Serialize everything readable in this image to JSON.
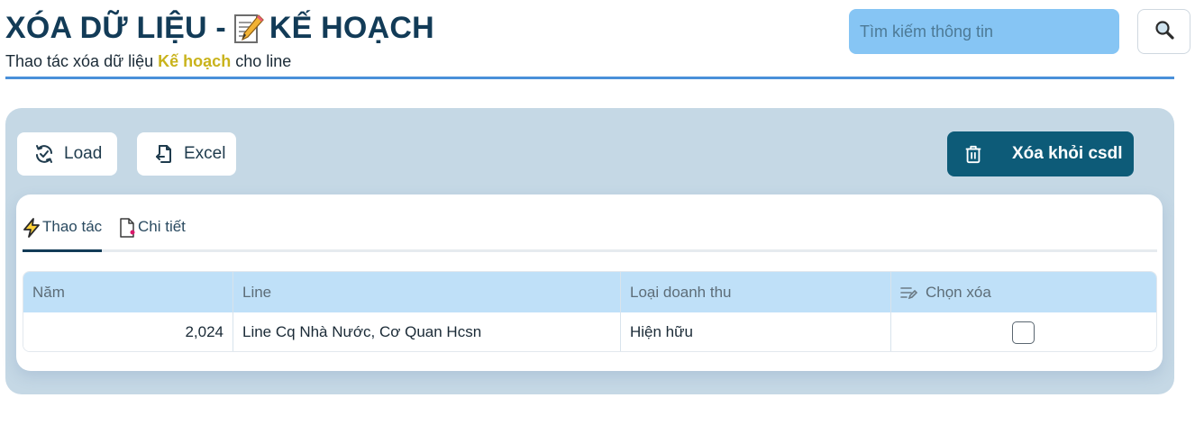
{
  "header": {
    "title_part1": "XÓA DỮ LIỆU -",
    "title_icon": "memo-icon",
    "title_part2": "KẾ HOẠCH",
    "subtitle_pre": "Thao tác xóa dữ liệu",
    "subtitle_highlight": "Kế hoạch",
    "subtitle_post": "cho line"
  },
  "search": {
    "placeholder": "Tìm kiếm thông tin",
    "value": "",
    "button_icon": "search-icon"
  },
  "toolbar": {
    "load_label": "Load",
    "load_icon": "refresh-icon",
    "excel_label": "Excel",
    "excel_icon": "file-export-icon",
    "delete_label": "Xóa khỏi csdl",
    "delete_icon": "trash-icon"
  },
  "tabs": [
    {
      "label": "Thao tác",
      "icon": "lightning-icon",
      "active": true
    },
    {
      "label": "Chi tiết",
      "icon": "document-icon",
      "active": false
    }
  ],
  "table": {
    "columns": [
      "Năm",
      "Line",
      "Loại doanh thu",
      "Chọn xóa"
    ],
    "rows": [
      {
        "nam": "2,024",
        "line": "Line Cq Nhà Nước, Cơ Quan Hcsn",
        "loai": "Hiện hữu",
        "chon": false
      }
    ]
  },
  "colors": {
    "accent": "#0d5b78",
    "search_bg": "#86c5f4",
    "highlight": "#c9b31c",
    "panel_bg": "#c5d8e5",
    "header_row": "#bfe0f8"
  }
}
